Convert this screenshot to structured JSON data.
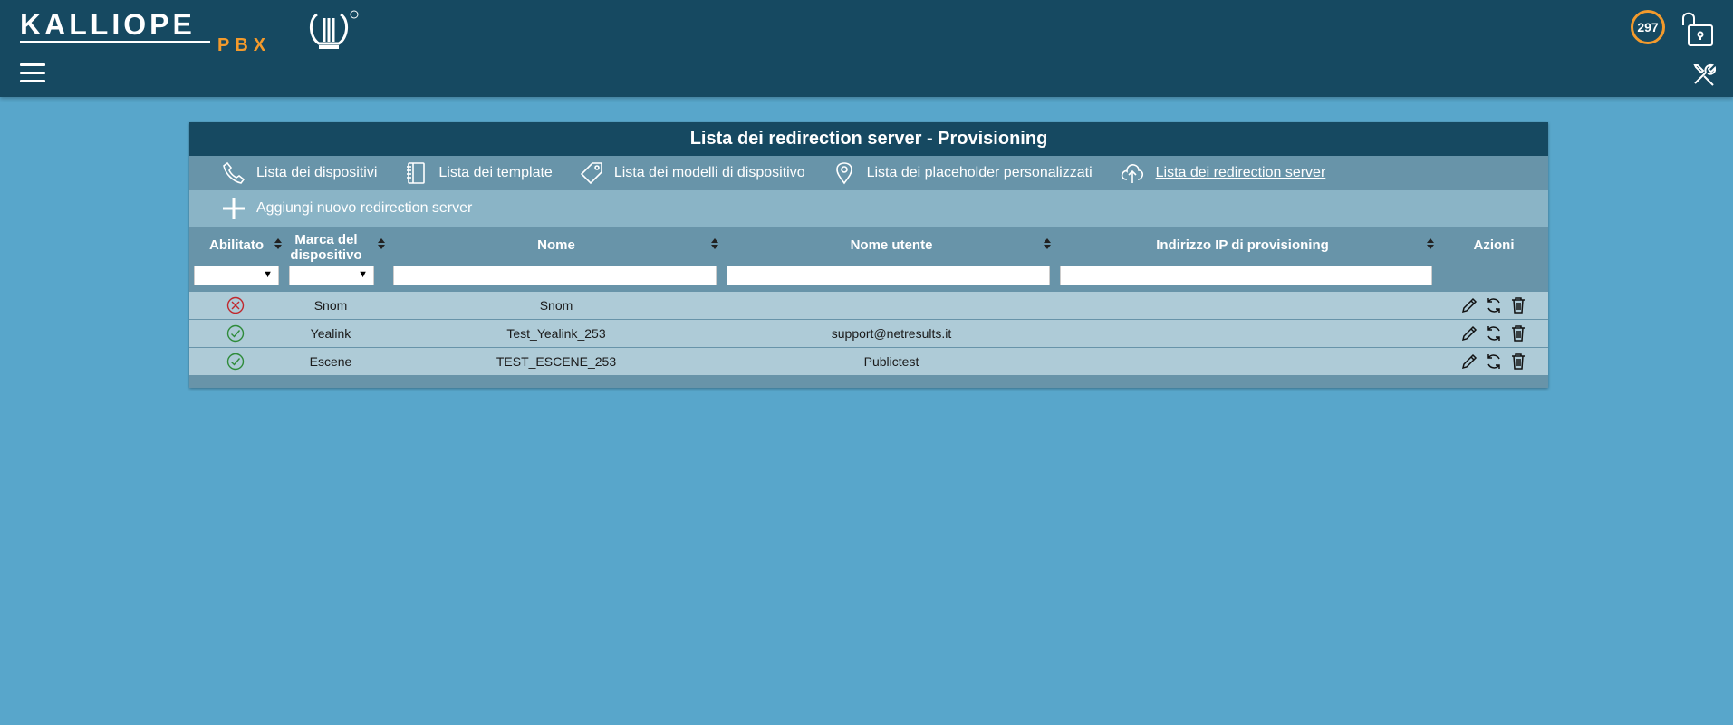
{
  "header": {
    "logo_text": "KALLIOPE",
    "logo_sub": "PBX",
    "counter": "297",
    "icons": [
      "menu-icon",
      "lock-open-icon",
      "tools-icon"
    ]
  },
  "panel": {
    "title": "Lista dei redirection server - Provisioning",
    "nav": [
      {
        "label": "Lista dei dispositivi",
        "icon": "phone-icon"
      },
      {
        "label": "Lista dei template",
        "icon": "notebook-icon"
      },
      {
        "label": "Lista dei modelli di dispositivo",
        "icon": "tag-icon"
      },
      {
        "label": "Lista dei placeholder personalizzati",
        "icon": "map-pin-icon"
      },
      {
        "label": "Lista dei redirection server",
        "icon": "cloud-upload-icon"
      }
    ],
    "add_label": "Aggiungi nuovo redirection server"
  },
  "table": {
    "columns": {
      "enabled": "Abilitato",
      "brand": "Marca del dispositivo",
      "name": "Nome",
      "username": "Nome utente",
      "ip": "Indirizzo IP di provisioning",
      "actions": "Azioni"
    },
    "filters": {
      "enabled": "",
      "brand": "",
      "name": "",
      "username": "",
      "ip": ""
    },
    "rows": [
      {
        "enabled": false,
        "brand": "Snom",
        "name": "Snom",
        "username": "",
        "ip": ""
      },
      {
        "enabled": true,
        "brand": "Yealink",
        "name": "Test_Yealink_253",
        "username": "support@netresults.it",
        "ip": ""
      },
      {
        "enabled": true,
        "brand": "Escene",
        "name": "TEST_ESCENE_253",
        "username": "Publictest",
        "ip": ""
      }
    ]
  },
  "colors": {
    "header_bg": "#164961",
    "page_bg": "#58a6cb",
    "accent_orange": "#f39a2c",
    "enabled_green": "#2e8b3a",
    "disabled_red": "#c0282d"
  }
}
